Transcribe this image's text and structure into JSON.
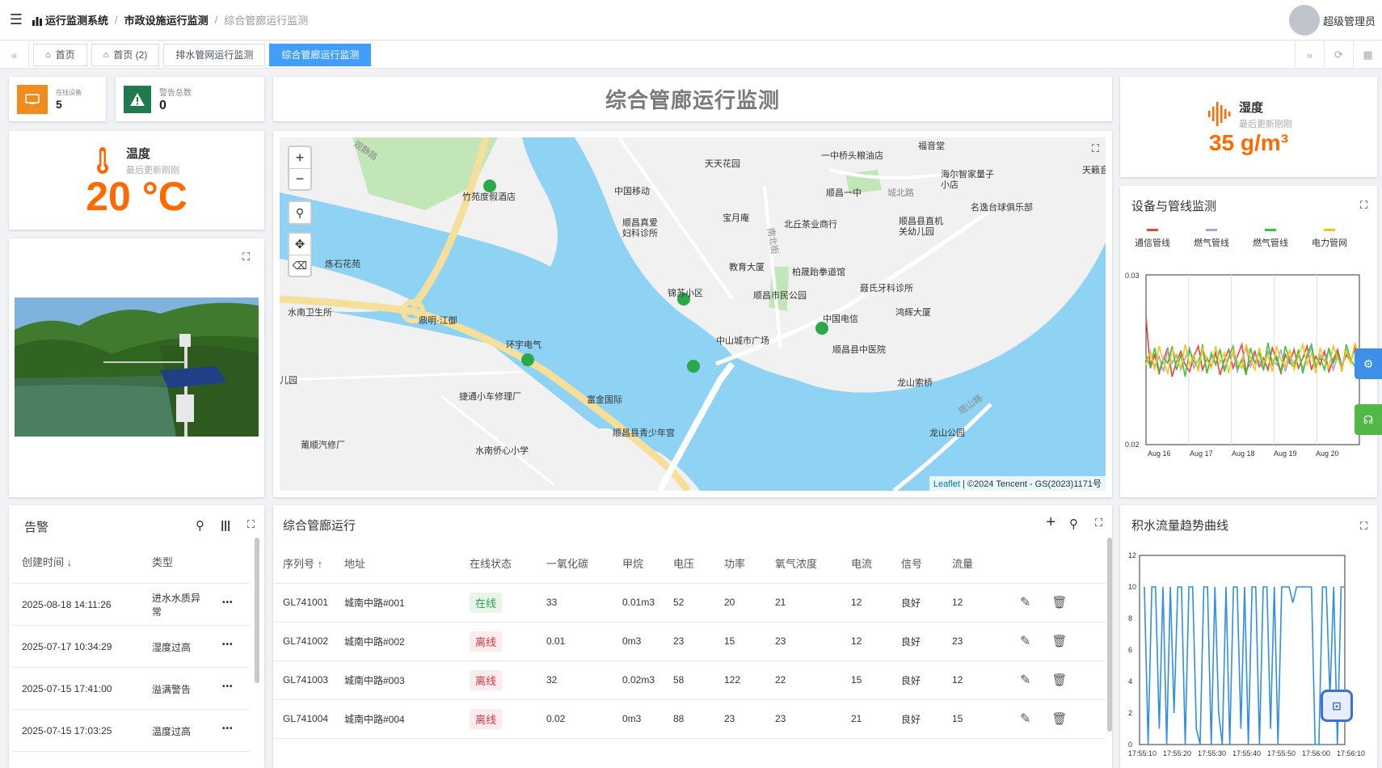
{
  "breadcrumb": [
    "运行监测系统",
    "市政设施运行监测",
    "综合管廊运行监测"
  ],
  "user": {
    "name": "超级管理员"
  },
  "tabs": [
    {
      "label": "首页",
      "home": true,
      "active": false
    },
    {
      "label": "首页 (2)",
      "home": true,
      "active": false
    },
    {
      "label": "排水管网运行监测",
      "home": false,
      "active": false
    },
    {
      "label": "综合管廊运行监测",
      "home": false,
      "active": true
    }
  ],
  "stats": {
    "online": {
      "label": "在线设备",
      "value": "5",
      "color": "#f08c1d"
    },
    "alarm": {
      "label": "警告总数",
      "value": "0",
      "color": "#1f7a4d"
    }
  },
  "page_title": "综合管廊运行监测",
  "temperature": {
    "name": "温度",
    "sub": "最后更新刚刚",
    "value": "20 °C"
  },
  "humidity": {
    "name": "湿度",
    "sub": "最后更新刚刚",
    "value": "35 g/m³"
  },
  "map": {
    "zoom_in": "+",
    "zoom_out": "−",
    "attribution_link": "Leaflet",
    "attribution_text": "| ©2024 Tencent - GS(2023)1171号",
    "pois": [
      {
        "name": "观静路"
      },
      {
        "name": "竹苑度假酒店"
      },
      {
        "name": "中国移动"
      },
      {
        "name": "天天花园"
      },
      {
        "name": "一中桥头粮油店"
      },
      {
        "name": "福音堂"
      },
      {
        "name": "海尔智家量子小店"
      },
      {
        "name": "天籁音乐"
      },
      {
        "name": "顺昌一中"
      },
      {
        "name": "城北路"
      },
      {
        "name": "名逸台球俱乐部"
      },
      {
        "name": "宝月庵"
      },
      {
        "name": "北丘茶业商行"
      },
      {
        "name": "顺昌县直机关幼儿园"
      },
      {
        "name": "顺昌真爱妇科诊所"
      },
      {
        "name": "炼石花苑"
      },
      {
        "name": "教育大厦"
      },
      {
        "name": "柏晟跆拳道馆"
      },
      {
        "name": "顺昌市民公园"
      },
      {
        "name": "聂氏牙科诊所"
      },
      {
        "name": "水南卫生所"
      },
      {
        "name": "锦苏小区"
      },
      {
        "name": "鼎明·江御"
      },
      {
        "name": "中国电信"
      },
      {
        "name": "鸿辉大厦"
      },
      {
        "name": "环宇电气"
      },
      {
        "name": "中山城市广场"
      },
      {
        "name": "顺昌县中医院"
      },
      {
        "name": "儿园"
      },
      {
        "name": "捷通小车修理厂"
      },
      {
        "name": "富金国际"
      },
      {
        "name": "龙山索桥"
      },
      {
        "name": "顺昌县青少年宫"
      },
      {
        "name": "龙山公园"
      },
      {
        "name": "莆顺汽修厂"
      },
      {
        "name": "水南侨心小学"
      },
      {
        "name": "塔山路"
      },
      {
        "name": "南北街"
      }
    ]
  },
  "pipeline_chart": {
    "title": "设备与管线监测",
    "legend": [
      {
        "name": "通信管线",
        "color": "#e8453c"
      },
      {
        "name": "燃气管线",
        "color": "#b39ddb"
      },
      {
        "name": "燃气管线",
        "color": "#37c837"
      },
      {
        "name": "电力管网",
        "color": "#f5c518"
      }
    ]
  },
  "alarm_panel": {
    "title": "告警",
    "col_time": "创建时间",
    "col_type": "类型",
    "rows": [
      {
        "time": "2025-08-18 14:11:26",
        "type": "进水水质异常"
      },
      {
        "time": "2025-07-17 10:34:29",
        "type": "湿度过高"
      },
      {
        "time": "2025-07-15 17:41:00",
        "type": "溢满警告"
      },
      {
        "time": "2025-07-15 17:03:25",
        "type": "温度过高"
      }
    ],
    "more": "•••"
  },
  "gallery_table": {
    "title": "综合管廊运行",
    "headers": [
      "序列号",
      "地址",
      "在线状态",
      "一氧化碳",
      "甲烷",
      "电压",
      "功率",
      "氧气浓度",
      "电流",
      "信号",
      "流量"
    ],
    "rows": [
      {
        "sn": "GL741001",
        "addr": "城南中路#001",
        "status": "在线",
        "online": true,
        "co": "33",
        "ch4": "0.01m3",
        "volt": "52",
        "power": "20",
        "o2": "21",
        "current": "12",
        "signal": "良好",
        "flow": "12"
      },
      {
        "sn": "GL741002",
        "addr": "城南中路#002",
        "status": "离线",
        "online": false,
        "co": "0.01",
        "ch4": "0m3",
        "volt": "23",
        "power": "15",
        "o2": "23",
        "current": "12",
        "signal": "良好",
        "flow": "23"
      },
      {
        "sn": "GL741003",
        "addr": "城南中路#003",
        "status": "离线",
        "online": false,
        "co": "32",
        "ch4": "0.02m3",
        "volt": "58",
        "power": "122",
        "o2": "22",
        "current": "15",
        "signal": "良好",
        "flow": "12"
      },
      {
        "sn": "GL741004",
        "addr": "城南中路#004",
        "status": "离线",
        "online": false,
        "co": "0.02",
        "ch4": "0m3",
        "volt": "88",
        "power": "23",
        "o2": "23",
        "current": "21",
        "signal": "良好",
        "flow": "15"
      }
    ]
  },
  "chart_data": [
    {
      "type": "line",
      "title": "设备与管线监测",
      "x": [
        "Aug 16",
        "Aug 17",
        "Aug 18",
        "Aug 19",
        "Aug 20"
      ],
      "ylim": [
        0.02,
        0.03
      ],
      "y_ticks": [
        "0.03",
        "0.02"
      ],
      "series": [
        {
          "name": "通信管线",
          "color": "#e8453c",
          "values": [
            0.0275,
            0.0245,
            0.0253,
            0.0242,
            0.025,
            0.0257,
            0.024,
            0.0249,
            0.0255,
            0.0247,
            0.0243,
            0.0252,
            0.0258,
            0.0244,
            0.0251,
            0.0246,
            0.0254,
            0.0241,
            0.025,
            0.0256,
            0.0245,
            0.0252,
            0.0259,
            0.0243,
            0.0249,
            0.0255,
            0.0246,
            0.0251,
            0.0244,
            0.0257,
            0.025,
            0.0242,
            0.0253,
            0.0248,
            0.0256,
            0.0245,
            0.0251,
            0.0258,
            0.0244,
            0.0252,
            0.0247,
            0.0255,
            0.0243,
            0.025,
            0.0256,
            0.0246,
            0.0253,
            0.0249,
            0.0257,
            0.0252
          ]
        },
        {
          "name": "燃气管线",
          "color": "#b39ddb",
          "values": [
            0.025,
            0.0254,
            0.0246,
            0.0252,
            0.0243,
            0.0256,
            0.0248,
            0.0253,
            0.0244,
            0.0251,
            0.0257,
            0.0245,
            0.025,
            0.0255,
            0.0242,
            0.0252,
            0.0248,
            0.0256,
            0.0245,
            0.0251,
            0.0254,
            0.0243,
            0.025,
            0.0257,
            0.0246,
            0.0253,
            0.0249,
            0.0244,
            0.0255,
            0.025,
            0.0247,
            0.0256,
            0.0243,
            0.0252,
            0.0248,
            0.0254,
            0.0245,
            0.0251,
            0.0257,
            0.0246,
            0.0253,
            0.0249,
            0.0256,
            0.0244,
            0.0252,
            0.0247,
            0.0255,
            0.025,
            0.0246,
            0.0253
          ]
        },
        {
          "name": "燃气管线",
          "color": "#37c837",
          "values": [
            0.0252,
            0.0246,
            0.0257,
            0.0243,
            0.0251,
            0.0248,
            0.0258,
            0.0244,
            0.0253,
            0.024,
            0.0256,
            0.0249,
            0.0245,
            0.0259,
            0.0242,
            0.0254,
            0.0247,
            0.0256,
            0.0243,
            0.0252,
            0.0258,
            0.0245,
            0.025,
            0.0241,
            0.0257,
            0.0248,
            0.0254,
            0.0244,
            0.026,
            0.0247,
            0.0252,
            0.0243,
            0.0258,
            0.0249,
            0.0245,
            0.0256,
            0.0242,
            0.0253,
            0.0259,
            0.0246,
            0.0251,
            0.0244,
            0.0257,
            0.0248,
            0.0254,
            0.0243,
            0.0259,
            0.025,
            0.0246,
            0.0256
          ]
        },
        {
          "name": "电力管网",
          "color": "#f5c518",
          "values": [
            0.0247,
            0.0255,
            0.0244,
            0.0258,
            0.0249,
            0.0242,
            0.0256,
            0.0251,
            0.0245,
            0.0259,
            0.0247,
            0.0253,
            0.0243,
            0.0257,
            0.025,
            0.0245,
            0.0258,
            0.0248,
            0.0254,
            0.0242,
            0.0256,
            0.0249,
            0.0245,
            0.0259,
            0.0251,
            0.0244,
            0.0257,
            0.0248,
            0.0253,
            0.0243,
            0.0258,
            0.025,
            0.0246,
            0.0256,
            0.0244,
            0.0252,
            0.0259,
            0.0247,
            0.0254,
            0.0242,
            0.0257,
            0.0249,
            0.0245,
            0.0258,
            0.0251,
            0.0244,
            0.0256,
            0.0248,
            0.026,
            0.0251
          ]
        }
      ]
    },
    {
      "type": "line",
      "title": "积水流量趋势曲线",
      "x": [
        "17:55:10",
        "17:55:20",
        "17:55:30",
        "17:55:40",
        "17:55:50",
        "17:56:00",
        "17:56:10"
      ],
      "ylim": [
        0,
        12
      ],
      "y_ticks": [
        "12",
        "10",
        "8",
        "6",
        "4",
        "2",
        "0"
      ],
      "series": [
        {
          "name": "",
          "color": "#2f8ee6",
          "values": [
            10,
            0,
            10,
            10,
            1,
            10,
            0,
            10,
            2,
            10,
            10,
            0,
            10,
            10,
            1,
            0,
            10,
            10,
            0,
            10,
            2,
            0,
            10,
            0,
            10,
            10,
            1,
            10,
            0,
            10,
            10,
            0,
            10,
            10,
            1,
            10,
            0,
            10,
            10,
            10,
            9,
            10,
            10,
            10,
            10,
            10,
            0,
            0,
            10,
            10,
            3,
            10,
            0,
            10,
            10
          ]
        }
      ]
    }
  ]
}
